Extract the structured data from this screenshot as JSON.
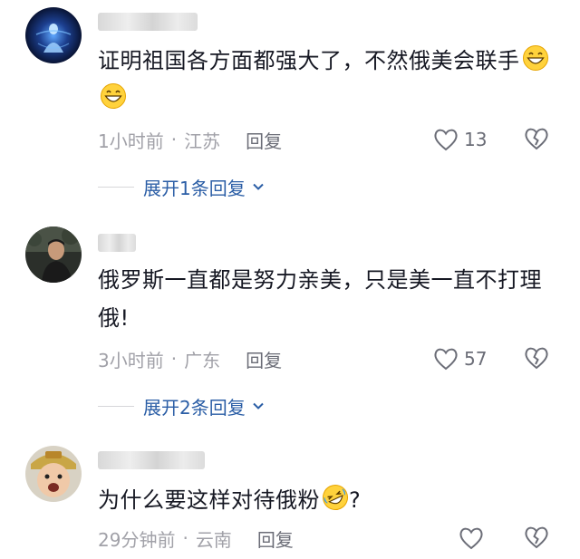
{
  "comments": [
    {
      "text": "证明祖国各方面都强大了，不然俄美会联手",
      "emoji_names": [
        "grinning-face-icon",
        "grinning-face-icon"
      ],
      "time": "1小时前",
      "location": "江苏",
      "reply_label": "回复",
      "like_count": "13",
      "expand_label": "展开1条回复"
    },
    {
      "text": "俄罗斯一直都是努力亲美，只是美一直不打理俄!",
      "time": "3小时前",
      "location": "广东",
      "reply_label": "回复",
      "like_count": "57",
      "expand_label": "展开2条回复"
    },
    {
      "text": "为什么要这样对待俄粉",
      "text_suffix": "?",
      "emoji_names": [
        "rolling-laughing-icon"
      ],
      "time": "29分钟前",
      "location": "云南",
      "reply_label": "回复",
      "like_count": ""
    }
  ],
  "separator": "·",
  "colors": {
    "text": "#161823",
    "meta": "#a1a1a8",
    "expand": "#2b5ea6",
    "icon": "#6b6d77"
  }
}
